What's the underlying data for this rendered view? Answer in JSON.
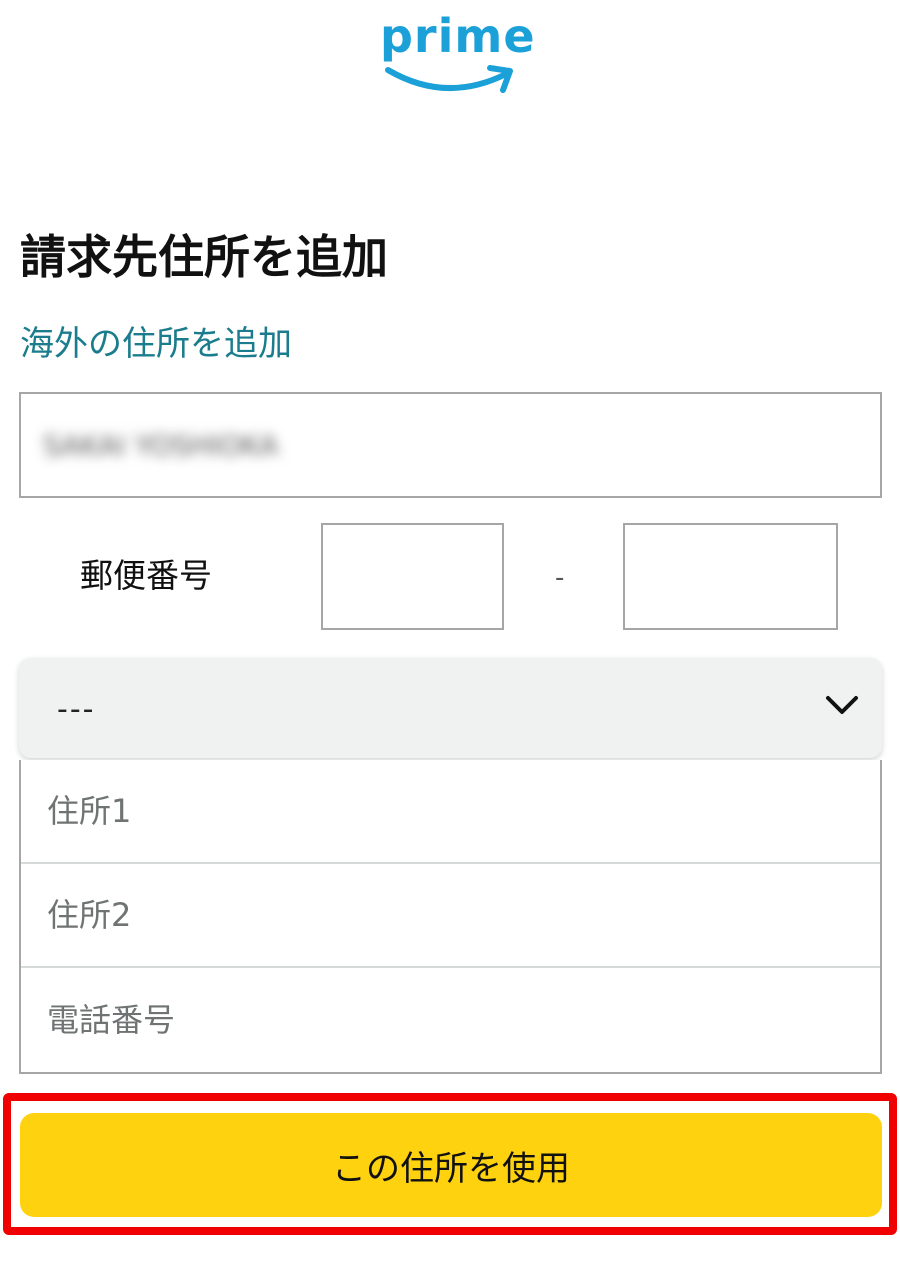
{
  "brand": {
    "logo_text": "prime",
    "logo_color": "#1ba1d8"
  },
  "page": {
    "title": "請求先住所を追加",
    "foreign_address_link": "海外の住所を追加"
  },
  "form": {
    "name_field": {
      "value": "SAKAI YOSHIOKA",
      "obscured": true
    },
    "postal": {
      "label": "郵便番号",
      "separator": "-",
      "part1_value": "",
      "part2_value": ""
    },
    "prefecture_select": {
      "selected": "---",
      "icon": "chevron-down-icon"
    },
    "address1": {
      "placeholder": "住所1",
      "value": ""
    },
    "address2": {
      "placeholder": "住所2",
      "value": ""
    },
    "phone": {
      "placeholder": "電話番号",
      "value": ""
    }
  },
  "actions": {
    "use_address_label": "この住所を使用",
    "button_color": "#ffd20f",
    "highlight_color": "#f00000"
  }
}
